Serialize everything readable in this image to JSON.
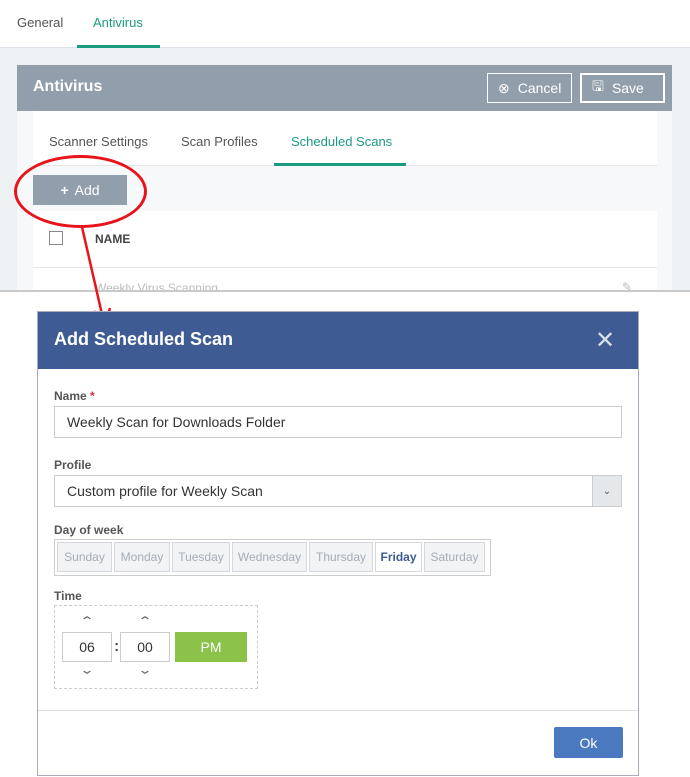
{
  "top_tabs": [
    {
      "label": "General"
    },
    {
      "label": "Antivirus",
      "active": true
    }
  ],
  "panel": {
    "title": "Antivirus",
    "cancel_label": "Cancel",
    "save_label": "Save"
  },
  "inner_tabs": [
    {
      "label": "Scanner Settings"
    },
    {
      "label": "Scan Profiles"
    },
    {
      "label": "Scheduled Scans",
      "active": true
    }
  ],
  "add_label": "Add",
  "table": {
    "header": "NAME",
    "rows": [
      "Weekly Virus Scanning"
    ]
  },
  "dialog": {
    "title": "Add Scheduled Scan",
    "name_label": "Name",
    "required_mark": "*",
    "name_value": "Weekly Scan for Downloads Folder",
    "profile_label": "Profile",
    "profile_value": "Custom profile for Weekly Scan",
    "day_label": "Day of week",
    "days": [
      "Sunday",
      "Monday",
      "Tuesday",
      "Wednesday",
      "Thursday",
      "Friday",
      "Saturday"
    ],
    "selected_day": "Friday",
    "time_label": "Time",
    "hour": "06",
    "minute": "00",
    "separator": ":",
    "ampm": "PM",
    "ok_label": "Ok"
  },
  "colors": {
    "accent": "#1b9a82",
    "dialog_header": "#3e5b93",
    "pm_button": "#8bc34a",
    "ok_button": "#4a79c0",
    "annotation": "#e8131b"
  }
}
